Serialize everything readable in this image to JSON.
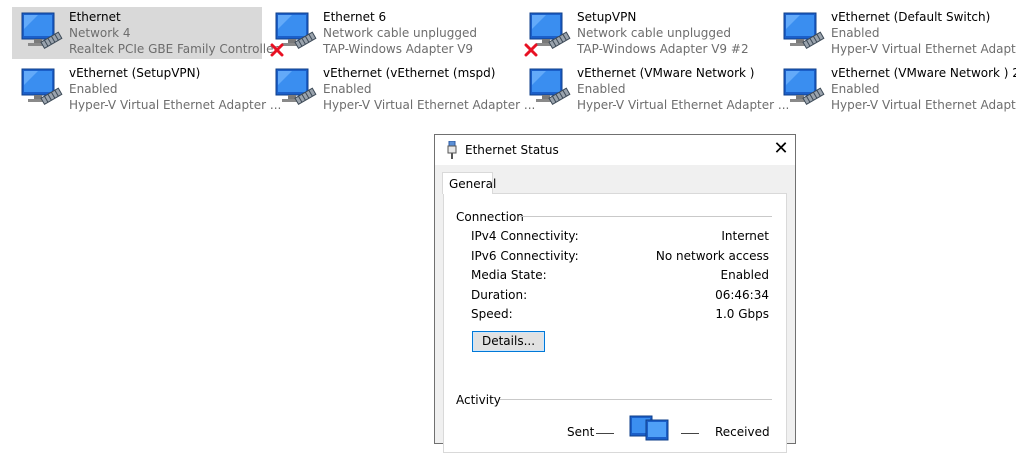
{
  "adapters": [
    {
      "name": "Ethernet",
      "status": "Network 4",
      "device": "Realtek PCIe GBE Family Controller",
      "selected": true,
      "error": false
    },
    {
      "name": "Ethernet 6",
      "status": "Network cable unplugged",
      "device": "TAP-Windows Adapter V9",
      "selected": false,
      "error": true
    },
    {
      "name": "SetupVPN",
      "status": "Network cable unplugged",
      "device": "TAP-Windows Adapter V9 #2",
      "selected": false,
      "error": true
    },
    {
      "name": "vEthernet (Default Switch)",
      "status": "Enabled",
      "device": "Hyper-V Virtual Ethernet Adapter",
      "selected": false,
      "error": false
    },
    {
      "name": "vEthernet (SetupVPN)",
      "status": "Enabled",
      "device": "Hyper-V Virtual Ethernet Adapter ...",
      "selected": false,
      "error": false
    },
    {
      "name": "vEthernet (vEthernet (mspd)",
      "status": "Enabled",
      "device": "Hyper-V Virtual Ethernet Adapter ...",
      "selected": false,
      "error": false
    },
    {
      "name": "vEthernet (VMware Network )",
      "status": "Enabled",
      "device": "Hyper-V Virtual Ethernet Adapter ...",
      "selected": false,
      "error": false
    },
    {
      "name": "vEthernet (VMware Network ) 2",
      "status": "Enabled",
      "device": "Hyper-V Virtual Ethernet Adapter ...",
      "selected": false,
      "error": false
    }
  ],
  "dialog": {
    "title": "Ethernet Status",
    "close_icon": "close-icon",
    "tab": "General",
    "connection": {
      "heading": "Connection",
      "rows": [
        {
          "label": "IPv4 Connectivity:",
          "value": "Internet"
        },
        {
          "label": "IPv6 Connectivity:",
          "value": "No network access"
        },
        {
          "label": "Media State:",
          "value": "Enabled"
        },
        {
          "label": "Duration:",
          "value": "06:46:34"
        },
        {
          "label": "Speed:",
          "value": "1.0 Gbps"
        }
      ],
      "details_button": "Details..."
    },
    "activity": {
      "heading": "Activity",
      "sent_label": "Sent",
      "received_label": "Received"
    }
  },
  "colors": {
    "selected_bg": "#d9d9d9",
    "accent_border": "#0078d7",
    "error_x": "#e81123",
    "secondary_text": "#6d6d6d"
  }
}
